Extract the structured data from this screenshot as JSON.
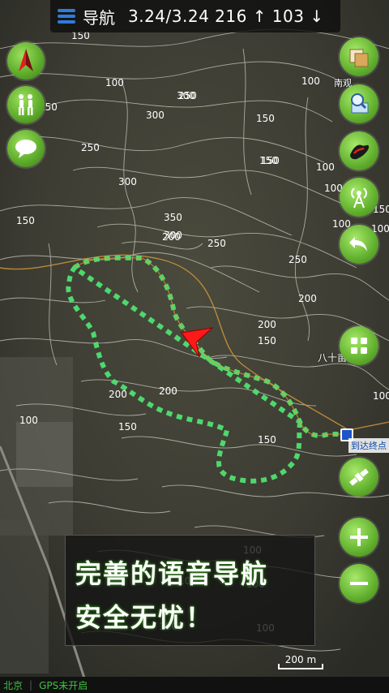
{
  "topbar": {
    "title": "导航",
    "stats": "3.24/3.24 216 ↑ 103 ↓"
  },
  "map": {
    "contour_labels": [
      "150",
      "100",
      "250",
      "300",
      "250",
      "200",
      "150",
      "100",
      "300",
      "350",
      "300",
      "250",
      "250",
      "100",
      "150",
      "150",
      "100",
      "250",
      "300",
      "150",
      "150",
      "100",
      "200",
      "200",
      "200",
      "150",
      "200",
      "100",
      "100",
      "100",
      "150",
      "150",
      "100",
      "100",
      "100",
      "100",
      "100"
    ],
    "place_labels": [
      "南观",
      "八十亩",
      "到达终点"
    ],
    "scale_label": "200 m"
  },
  "banner": {
    "line1": "完善的语音导航",
    "line2": "安全无忧！"
  },
  "status": {
    "city": "北京",
    "gps": "GPS未开启"
  },
  "colors": {
    "button_green": "#66b532",
    "track": "#4fe070",
    "arrow": "#ff1a1a"
  },
  "icons": {
    "left": [
      "compass-icon",
      "hikers-icon",
      "chat-icon"
    ],
    "right": [
      "layers-icon",
      "search-map-icon",
      "track-shoe-icon",
      "signal-tower-icon",
      "back-icon",
      "grid-icon",
      "satellite-icon",
      "zoom-in-icon",
      "zoom-out-icon"
    ]
  }
}
